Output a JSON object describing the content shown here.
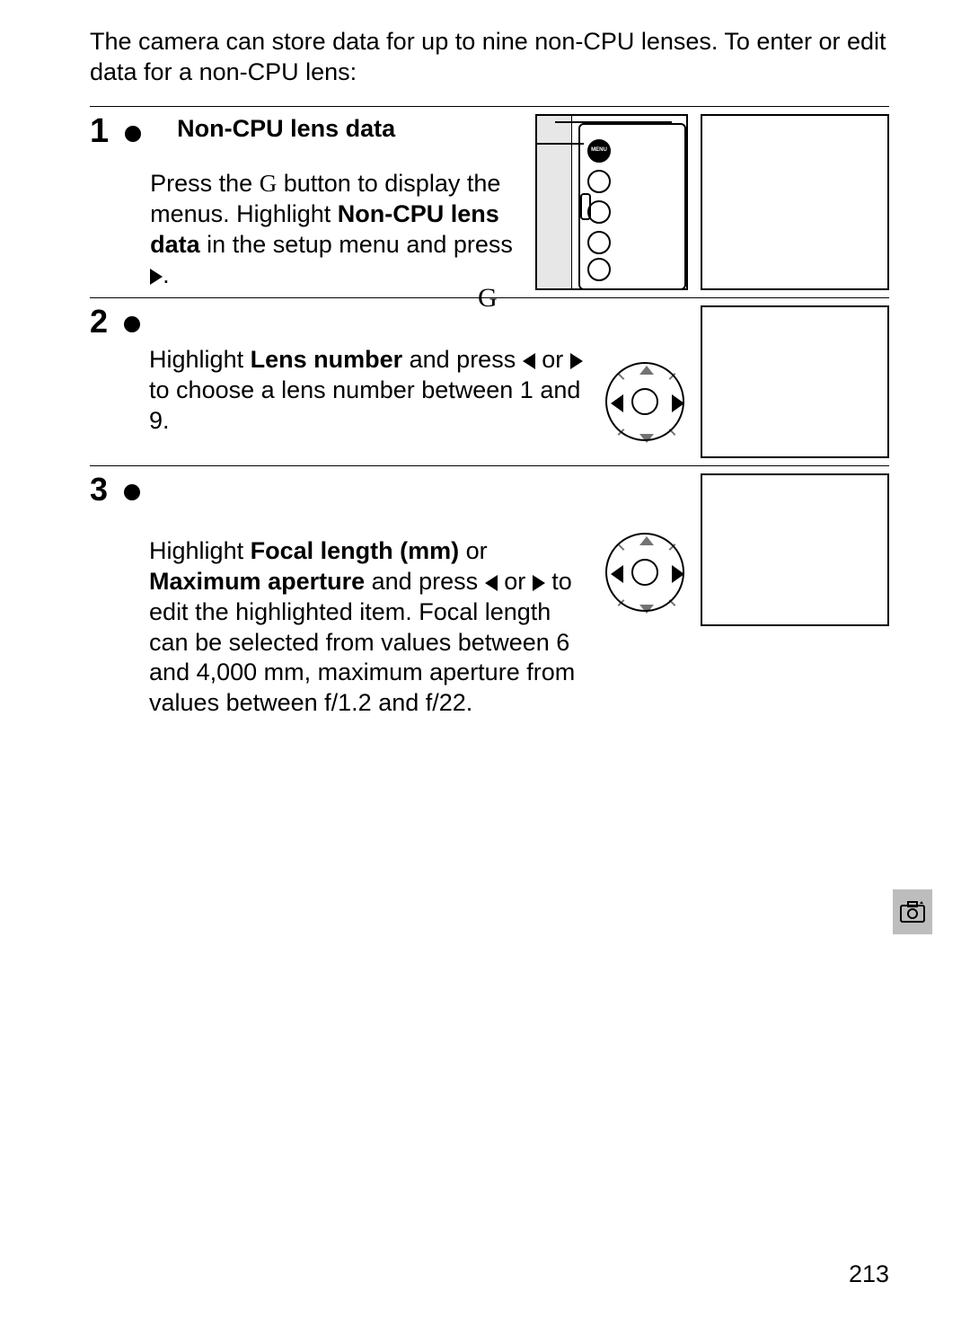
{
  "intro": "The camera can store data for up to nine non-CPU lenses.  To enter or edit data for a non-CPU lens:",
  "steps": {
    "s1": {
      "num": "1",
      "title": "Non-CPU lens data",
      "line1a": "Press the ",
      "g1": "G",
      "line1b": " button to display the menus. Highlight ",
      "bold1": "Non-CPU lens data",
      "line1c": " in the setup menu and press ",
      "g_label": "G"
    },
    "s2": {
      "num": "2",
      "line2a": "Highlight ",
      "bold2a": "Lens number",
      "line2b": " and press ",
      "line2c": " or ",
      "line2d": " to choose a lens number between 1 and 9."
    },
    "s3": {
      "num": "3",
      "line3a": "Highlight ",
      "bold3a": "Focal length (mm)",
      "line3b": " or ",
      "bold3b": "Maximum aperture",
      "line3c": " and press ",
      "line3d": " or ",
      "line3e": " to edit the highlighted item.  Focal length can be selected from values between 6 and 4,000 mm, maximum aperture from values between f/1.2 and f/22."
    }
  },
  "page_number": "213"
}
